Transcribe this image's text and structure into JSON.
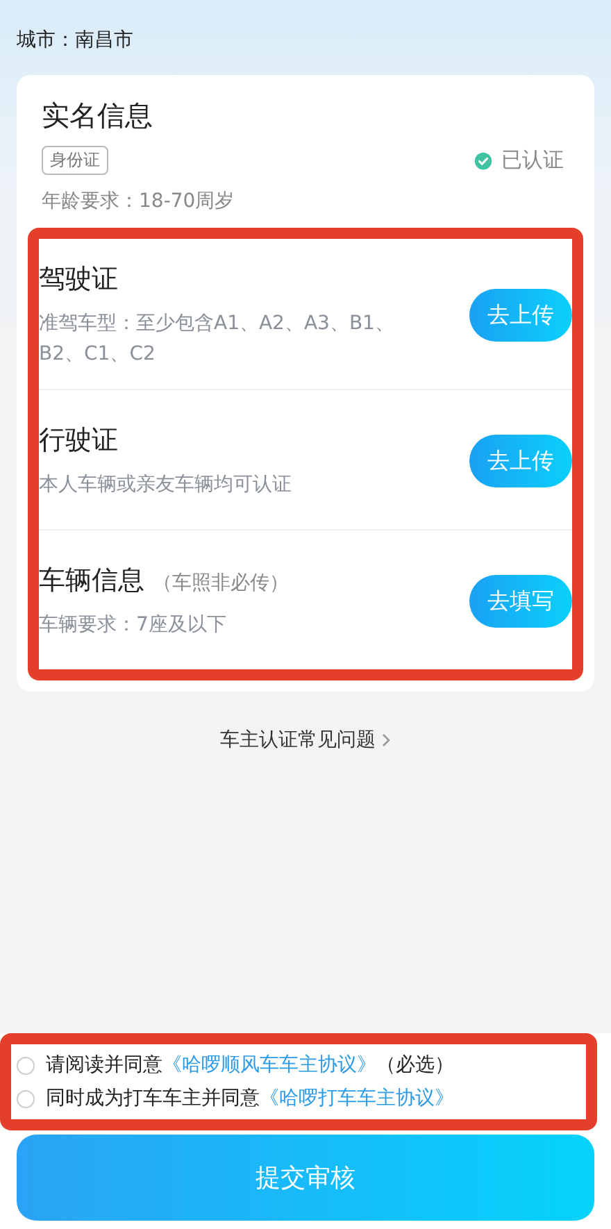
{
  "city": "城市：南昌市",
  "real_name": {
    "title": "实名信息",
    "tag": "身份证",
    "status": "已认证",
    "verified": true,
    "age": "年龄要求：18-70周岁"
  },
  "items": [
    {
      "title": "驾驶证",
      "desc": "准驾车型：至少包含A1、A2、A3、B1、B2、C1、C2",
      "button": "去上传"
    },
    {
      "title": "行驶证",
      "desc": "本人车辆或亲友车辆均可认证",
      "button": "去上传"
    },
    {
      "title": "车辆信息",
      "note": "（车照非必传）",
      "desc": "车辆要求：7座及以下",
      "button": "去填写"
    }
  ],
  "faq": "车主认证常见问题",
  "agreements": [
    {
      "text": "请阅读并同意",
      "link": "《哈啰顺风车车主协议》",
      "suffix": "（必选）",
      "checked": false
    },
    {
      "text": "同时成为打车车主并同意",
      "link": "《哈啰打车车主协议》",
      "checked": false
    }
  ],
  "submit": "提交审核"
}
